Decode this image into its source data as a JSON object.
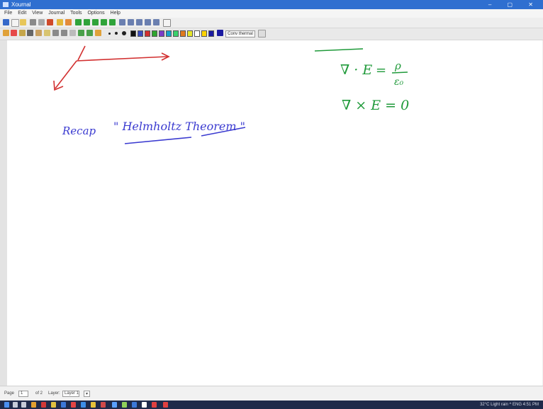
{
  "window": {
    "title": "Xournal"
  },
  "menu": [
    "File",
    "Edit",
    "View",
    "Journal",
    "Tools",
    "Options",
    "Help"
  ],
  "toolbar2": {
    "thickness_label": "Conv thermal"
  },
  "colors": [
    "#111111",
    "#3b4dbf",
    "#d33030",
    "#2ea52e",
    "#7a3cc8",
    "#16a0c8",
    "#3ad06c",
    "#e07a1e",
    "#e6e62a",
    "#ffffff",
    "#ffd400",
    "#1a1aa0"
  ],
  "canvas": {
    "recap_text": "Recap",
    "helmholtz_text": "\" Helmholtz Theorem \"",
    "eq1_lhs": "∇ · E",
    "eq1_rhs_num": "ρ",
    "eq1_rhs_den": "ε₀",
    "eq2": "∇ × E  = 0",
    "ink_colors": {
      "blue": "#3a3ad0",
      "green": "#1f9a3a",
      "red": "#d23030"
    }
  },
  "pagebar": {
    "page_label": "Page",
    "page_value": "1",
    "of_label": "of 2",
    "layer_label": "Layer:",
    "layer_value": "Layer 1"
  },
  "taskbar": {
    "tray_text": "32°C Light rain  ^  ENG  4:51 PM"
  }
}
